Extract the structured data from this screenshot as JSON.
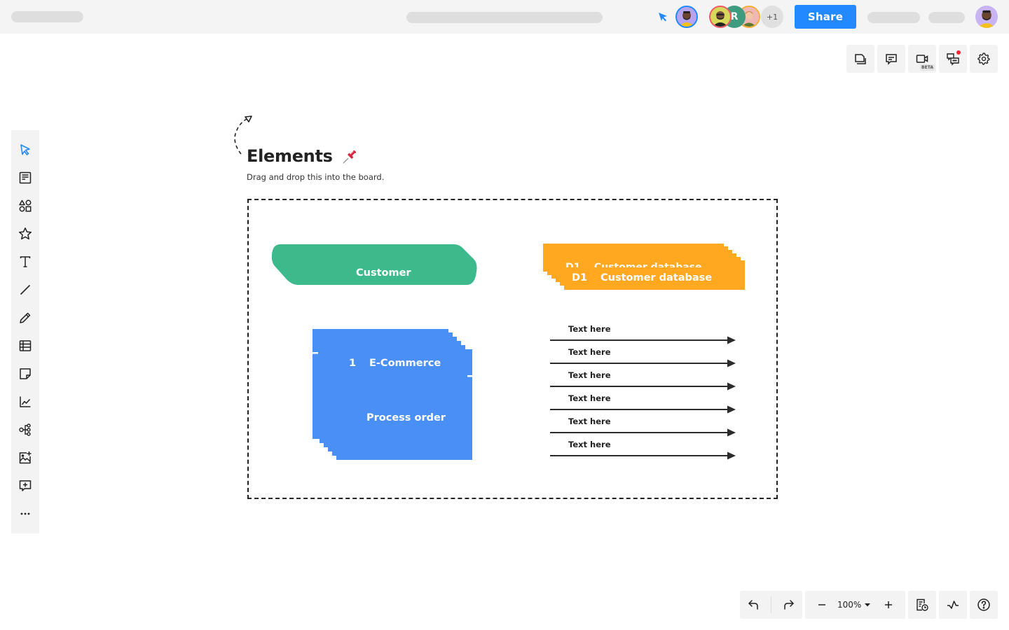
{
  "topbar": {
    "collaborators_overflow": "+1",
    "share_label": "Share",
    "collaborator_initial": "R"
  },
  "top_right_actions": [
    {
      "name": "pages-icon"
    },
    {
      "name": "comment-icon"
    },
    {
      "name": "video-icon",
      "badge": "BETA"
    },
    {
      "name": "chat-icon",
      "notification": true
    },
    {
      "name": "settings-icon"
    }
  ],
  "sidebar": {
    "items": [
      {
        "name": "select-tool",
        "icon": "cursor-icon",
        "active": true
      },
      {
        "name": "template-tool",
        "icon": "template-icon"
      },
      {
        "name": "shapes-tool",
        "icon": "shapes-icon"
      },
      {
        "name": "stickers-tool",
        "icon": "star-icon"
      },
      {
        "name": "text-tool",
        "icon": "text-icon"
      },
      {
        "name": "line-tool",
        "icon": "line-icon"
      },
      {
        "name": "pen-tool",
        "icon": "pencil-icon"
      },
      {
        "name": "table-tool",
        "icon": "table-icon"
      },
      {
        "name": "sticky-note-tool",
        "icon": "sticky-note-icon"
      },
      {
        "name": "chart-tool",
        "icon": "chart-icon"
      },
      {
        "name": "mindmap-tool",
        "icon": "mindmap-icon"
      },
      {
        "name": "image-tool",
        "icon": "add-image-icon"
      },
      {
        "name": "add-comment-tool",
        "icon": "add-comment-icon"
      },
      {
        "name": "more-tools",
        "icon": "more-icon"
      }
    ]
  },
  "board": {
    "title": "Elements",
    "title_emoji": "📌",
    "subtitle": "Drag and drop this into the board.",
    "external_entity": {
      "label": "Customer",
      "color": "#3dba8c"
    },
    "data_store": {
      "id": "D1",
      "label": "Customer database",
      "color": "#ffa820"
    },
    "process": {
      "id": "1",
      "category": "E-Commerce",
      "label": "Process order",
      "color": "#4a8ff5"
    },
    "arrows": [
      {
        "label": "Text here"
      },
      {
        "label": "Text here"
      },
      {
        "label": "Text here"
      },
      {
        "label": "Text here"
      },
      {
        "label": "Text here"
      },
      {
        "label": "Text here"
      }
    ]
  },
  "bottom_bar": {
    "zoom_level": "100%",
    "accent": "#2389ff"
  }
}
